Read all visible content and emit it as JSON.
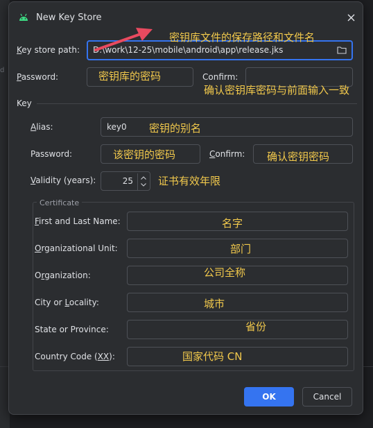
{
  "background": {
    "side_text": "d"
  },
  "dialog": {
    "title": "New Key Store",
    "keystore": {
      "path_label_k": "K",
      "path_label_rest": "ey store path:",
      "path_value": "D:\\work\\12-25\\mobile\\android\\app\\release.jks",
      "password_label_p": "P",
      "password_label_rest": "assword:",
      "confirm_label_rest": "onfirm:",
      "confirm_label_c": "C"
    },
    "key": {
      "section_label": "Key",
      "alias_label_a": "A",
      "alias_label_rest": "lias:",
      "alias_value": "key0",
      "password_label_p": "P",
      "password_label_rest": "assword:",
      "confirm_label_c": "C",
      "confirm_label_rest": "onfirm:",
      "validity_label_v": "V",
      "validity_label_rest": "alidity (years):",
      "validity_value": "25"
    },
    "certificate": {
      "legend": "Certificate",
      "fields": [
        {
          "u": "F",
          "rest": "irst and Last Name:"
        },
        {
          "u": "O",
          "rest": "rganizational Unit:"
        },
        {
          "pre": "O",
          "u": "r",
          "rest": "ganization:"
        },
        {
          "pre": "City or ",
          "u": "L",
          "rest": "ocality:"
        },
        {
          "pre": "State or Province:",
          "u": "",
          "rest": ""
        },
        {
          "pre": "Country Code (",
          "u": "XX",
          "rest": "):"
        }
      ]
    },
    "buttons": {
      "ok": "OK",
      "cancel": "Cancel"
    }
  },
  "annotations": {
    "path": "密钥库文件的保存路径和文件名",
    "keystore_password": "密钥库的密码",
    "keystore_confirm": "确认密钥库密码与前面输入一致",
    "alias": "密钥的别名",
    "key_password": "该密钥的密码",
    "key_confirm": "确认密钥密码",
    "validity": "证书有效年限",
    "name": "名字",
    "unit": "部门",
    "organization": "公司全称",
    "city": "城市",
    "state": "省份",
    "country": "国家代码  CN"
  },
  "colors": {
    "accent": "#3574f0",
    "annotation": "#f2c94c",
    "arrow": "#e84a5f"
  }
}
